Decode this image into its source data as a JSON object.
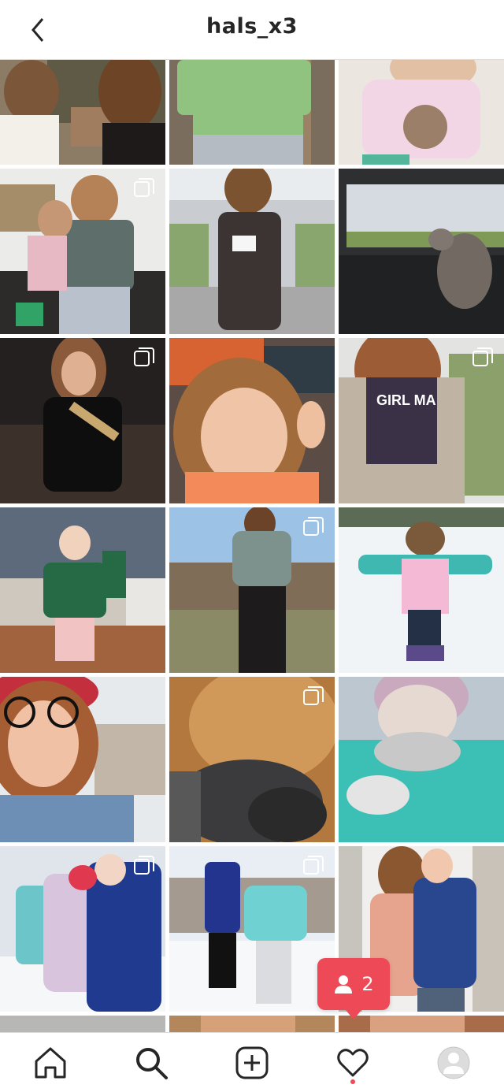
{
  "header": {
    "username": "hals_x3"
  },
  "notification": {
    "count": "2"
  },
  "icons": {
    "back": "chevron-left-icon",
    "multi": "multiple-photos-icon",
    "home": "home-icon",
    "search": "search-icon",
    "create": "add-post-icon",
    "activity": "heart-icon",
    "profile": "profile-avatar",
    "person": "person-icon"
  },
  "colors": {
    "notification_badge": "#ed4956",
    "text": "#262626",
    "divider": "#dbdbdb"
  },
  "grid": {
    "tiles": [
      {
        "desc": "two girls outdoors",
        "multi": false
      },
      {
        "desc": "green sweater",
        "multi": false
      },
      {
        "desc": "girl pink shirt",
        "multi": false
      },
      {
        "desc": "mom and daughter in shop",
        "multi": true
      },
      {
        "desc": "vaccine card selfie",
        "multi": false
      },
      {
        "desc": "cat in car",
        "multi": false
      },
      {
        "desc": "bride squad sash",
        "multi": true
      },
      {
        "desc": "child peace sign",
        "multi": false
      },
      {
        "desc": "girl mama tshirt",
        "multi": true
      },
      {
        "desc": "child in store",
        "multi": false
      },
      {
        "desc": "woman in park",
        "multi": true
      },
      {
        "desc": "child in snow",
        "multi": false
      },
      {
        "desc": "woman red beanie",
        "multi": false
      },
      {
        "desc": "dog and cat",
        "multi": true
      },
      {
        "desc": "blowing snow",
        "multi": false
      },
      {
        "desc": "family in snow",
        "multi": true
      },
      {
        "desc": "snow walk",
        "multi": true
      },
      {
        "desc": "couple on stairs",
        "multi": false
      }
    ]
  }
}
